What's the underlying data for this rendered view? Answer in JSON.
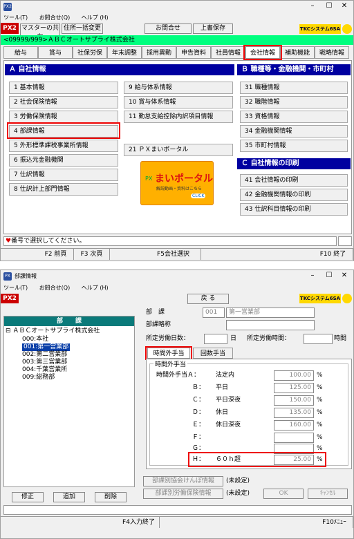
{
  "w1": {
    "titlebar_icon": "PX2",
    "menu": [
      "ツール(T)",
      "お問合せ(Q)",
      "ヘルプ (H)"
    ],
    "toolbar": {
      "px2": "PX2",
      "master_share": "マスターの共有",
      "address_change": "住所一括変更",
      "inquiry": "お問合せ",
      "overwrite_save": "上書保存",
      "logo": "TKCシステム6SA"
    },
    "company": "<09999/999>ＡＢＣオートサプライ株式会社",
    "tabs": [
      "給与",
      "賞与",
      "社保労保",
      "年末調整",
      "採用異動",
      "申告資料",
      "社員情報",
      "会社情報",
      "補助機能",
      "戦略情報"
    ],
    "section_a": "Ａ 自社情報",
    "section_b": "Ｂ 職種等・金融機関・市町村",
    "section_c": "Ｃ 自社情報の印刷",
    "col1": [
      "1 基本情報",
      "2 社会保険情報",
      "3 労働保険情報",
      "4 部課情報",
      "5 外形標準課税事業所情報",
      "6 振込元金融機関",
      "7 仕訳情報",
      "8 仕訳計上部門情報"
    ],
    "col2": [
      "9 給与体系情報",
      "10 賞与体系情報",
      "11 勤怠支給控除内訳項目情報"
    ],
    "portal_item": "21 ＰＸまいポータル",
    "portal_banner": {
      "title": "まいポータル",
      "sub": "解説動画・資料はこちら",
      "click": "CLICK",
      "px": "PX"
    },
    "colb": [
      "31 職種情報",
      "32 職階情報",
      "33 資格情報",
      "34 金融機関情報",
      "35 市町村情報"
    ],
    "colc": [
      "41 会社情報の印刷",
      "42 金融機関情報の印刷",
      "43 仕訳科目情報の印刷"
    ],
    "status": "番号で選択してください。",
    "fkeys": [
      "F2 前頁",
      "F3 次頁",
      "F5会社選択",
      "F10 終了"
    ]
  },
  "w2": {
    "title": "部課情報",
    "menu": [
      "ツール(T)",
      "お問合せ(Q)",
      "ヘルプ (H)"
    ],
    "px2": "PX2",
    "back": "戻 る",
    "logo": "TKCシステム6SA",
    "tree_header": "部　　課",
    "tree": [
      "⊟ ＡＢＣオートサプライ株式会社",
      "000:本社",
      "001:第一営業部",
      "002:第二営業部",
      "003:第三営業部",
      "004:千葉営業所",
      "009:総務部"
    ],
    "fields": {
      "bu_ka_label": "部　課",
      "bu_ka_code": "001",
      "bu_ka_name": "第一営業部",
      "abbrev_label": "部課略称",
      "days_label": "所定労働日数：",
      "days_unit": "日",
      "hours_label": "所定労働時間：",
      "hours_unit": "時間"
    },
    "subtabs": [
      "時間外手当",
      "回数手当"
    ],
    "group_title": "時間外手当",
    "ot_header": "時間外手当Ａ：",
    "ot_rows": [
      {
        "key": "Ａ：",
        "label": "法定内",
        "value": "100.00",
        "unit": "%"
      },
      {
        "key": "Ｂ：",
        "label": "平日",
        "value": "125.00",
        "unit": "%"
      },
      {
        "key": "Ｃ：",
        "label": "平日深夜",
        "value": "150.00",
        "unit": "%"
      },
      {
        "key": "Ｄ：",
        "label": "休日",
        "value": "135.00",
        "unit": "%"
      },
      {
        "key": "Ｅ：",
        "label": "休日深夜",
        "value": "160.00",
        "unit": "%"
      },
      {
        "key": "Ｆ：",
        "label": "",
        "value": "",
        "unit": "%"
      },
      {
        "key": "Ｇ：",
        "label": "",
        "value": "",
        "unit": "%"
      },
      {
        "key": "Ｈ：",
        "label": "６０ｈ超",
        "value": "25.00",
        "unit": "%"
      }
    ],
    "extra": [
      {
        "btn": "部課別協会けんぽ情報",
        "status": "(未設定)"
      },
      {
        "btn": "部課別労働保険情報",
        "status": "(未設定)"
      }
    ],
    "ok": "OK",
    "cancel": "ｷｬﾝｾﾙ",
    "tree_buttons": [
      "修正",
      "追加",
      "削除"
    ],
    "fkeys": [
      "F4入力終了",
      "F10ﾒﾆｭｰ"
    ]
  }
}
